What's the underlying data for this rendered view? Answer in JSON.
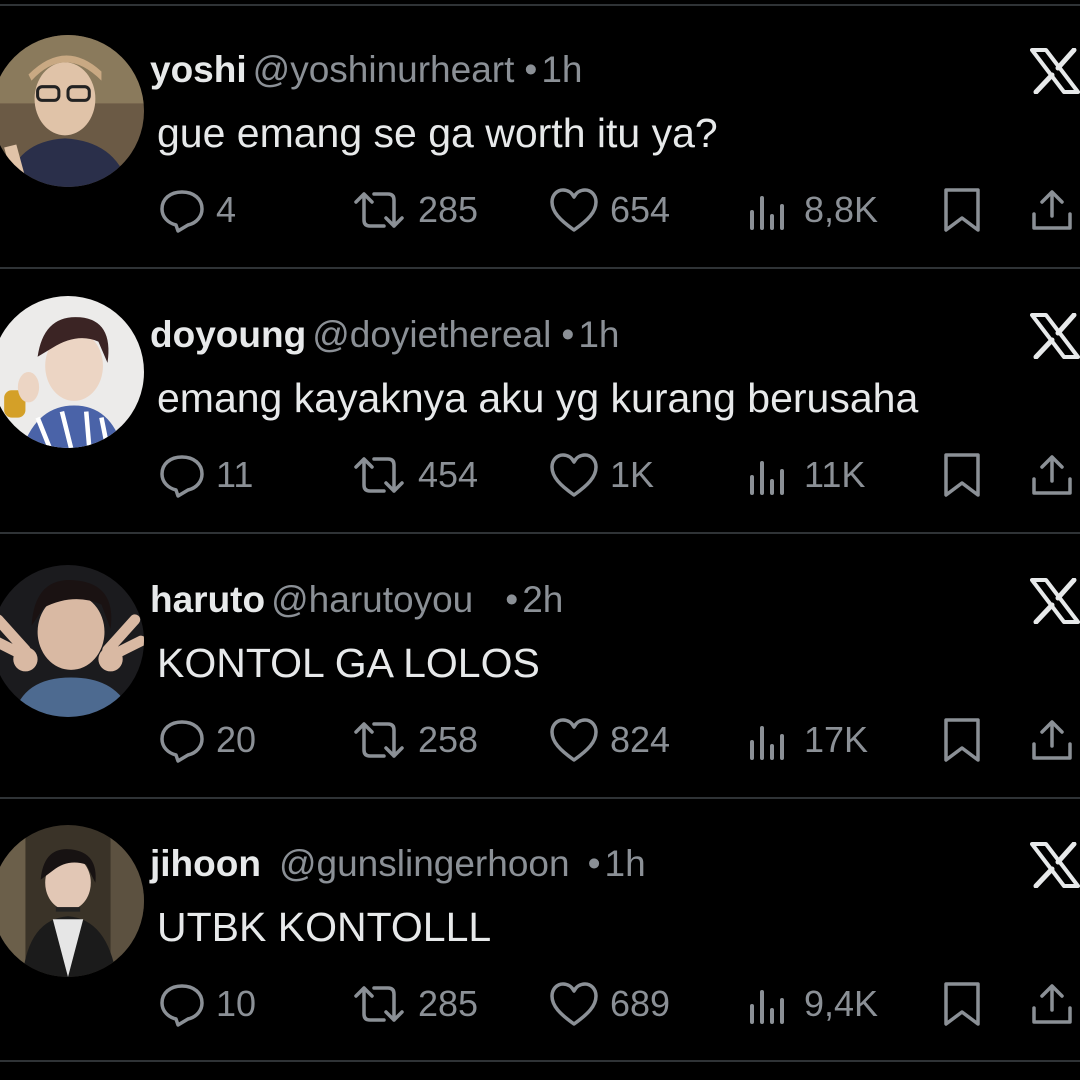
{
  "tweets": [
    {
      "name": "yoshi",
      "handle": "@yoshinurheart",
      "dot": "•",
      "time": "1h",
      "text": "gue emang se ga worth itu ya?",
      "replies": "4",
      "retweets": "285",
      "likes": "654",
      "views": "8,8K"
    },
    {
      "name": "doyoung",
      "handle": "@doyiethereal",
      "dot": "•",
      "time": "1h",
      "text": "emang kayaknya aku yg kurang berusaha",
      "replies": "11",
      "retweets": "454",
      "likes": "1K",
      "views": "11K"
    },
    {
      "name": "haruto",
      "handle": "@harutoyou",
      "dot": "•",
      "time": "2h",
      "text": "KONTOL GA LOLOS",
      "replies": "20",
      "retweets": "258",
      "likes": "824",
      "views": "17K"
    },
    {
      "name": "jihoon",
      "handle": "@gunslingerhoon",
      "dot": "•",
      "time": "1h",
      "text": "UTBK KONTOLLL",
      "replies": "10",
      "retweets": "285",
      "likes": "689",
      "views": "9,4K"
    }
  ],
  "icons": {
    "reply": "speech-bubble-icon",
    "retweet": "retweet-arrows-icon",
    "like": "heart-icon",
    "views": "bar-chart-icon",
    "bookmark": "bookmark-icon",
    "share": "share-upload-icon",
    "brand": "x-logo-icon"
  },
  "colors": {
    "background": "#000000",
    "text": "#e7e9ea",
    "secondary": "#8b9096",
    "divider": "#2f3336"
  }
}
